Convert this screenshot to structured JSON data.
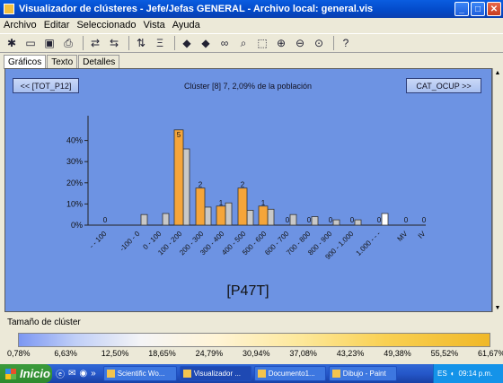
{
  "window": {
    "title": "Visualizador de clústeres - Jefe/Jefas GENERAL - Archivo local: general.vis",
    "minimize": "_",
    "maximize": "□",
    "close": "✕"
  },
  "menu": [
    "Archivo",
    "Editar",
    "Seleccionado",
    "Vista",
    "Ayuda"
  ],
  "toolbar_icons": [
    "new-icon",
    "open-icon",
    "save-icon",
    "print-icon",
    "back-icon",
    "forward-icon",
    "sort-icon",
    "filter-icon",
    "left-arrow-icon",
    "right-arrow-icon",
    "binoculars-icon",
    "find-icon",
    "select-icon",
    "zoom-in-icon",
    "zoom-out-icon",
    "zoom-fit-icon",
    "help-icon"
  ],
  "tabs": [
    "Gráficos",
    "Texto",
    "Detalles"
  ],
  "panel": {
    "prev_button": "<< [TOT_P12]",
    "next_button": "CAT_OCUP >>",
    "cluster_info": "Clúster [8] 7, 2,09% de la población"
  },
  "chart_data": {
    "type": "bar",
    "xlabel": "[P47T]",
    "ylabel": "",
    "ylim": [
      0,
      50
    ],
    "ytick_labels": [
      "0%",
      "10%",
      "20%",
      "30%",
      "40%"
    ],
    "ytick_values": [
      0,
      10,
      20,
      30,
      40
    ],
    "categories": [
      "- - 100",
      "-100 - 0",
      "0 - 100",
      "100 - 200",
      "200 - 300",
      "300 - 400",
      "400 - 500",
      "500 - 600",
      "600 - 700",
      "700 - 800",
      "800 - 900",
      "900 - 1.000",
      "1.000 - - -",
      "MV",
      "IV"
    ],
    "series": [
      {
        "name": "cluster",
        "color": "#f5a53a",
        "values": [
          0,
          0,
          0,
          45,
          17.5,
          9,
          17.5,
          9,
          0,
          0,
          0,
          0,
          0,
          0,
          0
        ]
      },
      {
        "name": "population",
        "color": "#c8c8c8",
        "values": [
          0,
          5,
          5.5,
          36,
          8.5,
          10.5,
          7,
          7.5,
          5,
          4,
          2.5,
          2.5,
          5.5,
          0,
          0
        ]
      }
    ],
    "bar_labels": [
      "0",
      "",
      "",
      "5",
      "2",
      "1",
      "2",
      "1",
      "0",
      "0",
      "0",
      "0",
      "0",
      "0",
      "0"
    ],
    "bar_labels_visible": [
      true,
      false,
      false,
      true,
      true,
      true,
      true,
      true,
      true,
      true,
      true,
      true,
      true,
      true,
      true
    ],
    "highlight_color": "#ffffff",
    "grid": false
  },
  "size_bar": {
    "label": "Tamaño de clúster",
    "ticks": [
      "0,78%",
      "6,63%",
      "12,50%",
      "18,65%",
      "24,79%",
      "30,94%",
      "37,08%",
      "43,23%",
      "49,38%",
      "55,52%",
      "61,67%"
    ]
  },
  "taskbar": {
    "start": "Inicio",
    "quick_launch": [
      "ie-icon",
      "mail-icon",
      "firefox-icon",
      "»"
    ],
    "tasks": [
      {
        "label": "Scientific Wo...",
        "active": false
      },
      {
        "label": "Visualizador ...",
        "active": true
      },
      {
        "label": "Documento1...",
        "active": false
      },
      {
        "label": "Dibujo - Paint",
        "active": false
      }
    ],
    "tray_lang": "ES",
    "clock": "09:14 p.m."
  }
}
